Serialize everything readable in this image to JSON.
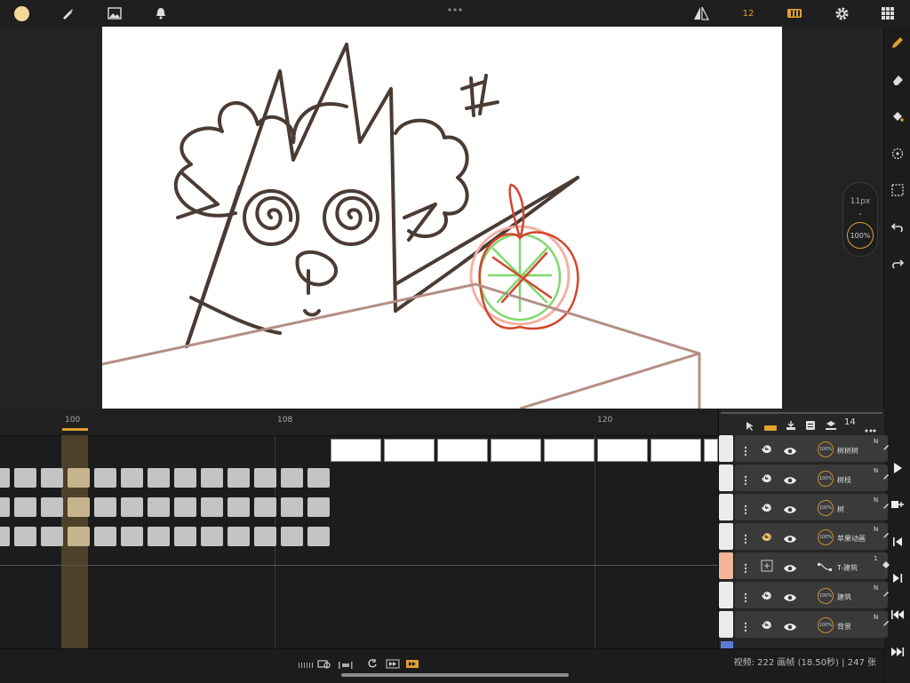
{
  "toolbar": {
    "frame_count": "12",
    "icons": [
      "color-swatch-icon",
      "brush-icon",
      "image-icon",
      "bell-icon",
      "more-icon",
      "flip-icon",
      "onion-skin-icon",
      "gear-icon",
      "grid-icon"
    ]
  },
  "brush": {
    "size_label": "11px",
    "opacity_label": "100%"
  },
  "timeline": {
    "ruler_labels": [
      "100",
      "108",
      "120"
    ],
    "current_frame": "100"
  },
  "layer_panel": {
    "header_count": "14",
    "layers": [
      {
        "name": "树树树",
        "opacity": "100%",
        "mode": "N",
        "swatch": "#ececec"
      },
      {
        "name": "树枝",
        "opacity": "100%",
        "mode": "N",
        "swatch": "#ececec"
      },
      {
        "name": "树",
        "opacity": "100%",
        "mode": "N",
        "swatch": "#ececec"
      },
      {
        "name": "苹果动画",
        "opacity": "100%",
        "mode": "N",
        "swatch": "#ececec"
      },
      {
        "name": "T-建筑",
        "opacity": "",
        "mode": "1",
        "swatch": "#f2b595"
      },
      {
        "name": "建筑",
        "opacity": "100%",
        "mode": "N",
        "swatch": "#ececec"
      },
      {
        "name": "背景",
        "opacity": "100%",
        "mode": "N",
        "swatch": "#ececec"
      }
    ]
  },
  "status": {
    "text": "视频: 222 画帧 (18.50秒) | 247 张"
  },
  "colors": {
    "accent": "#e0a030",
    "primary_color": "#f6d59a"
  }
}
